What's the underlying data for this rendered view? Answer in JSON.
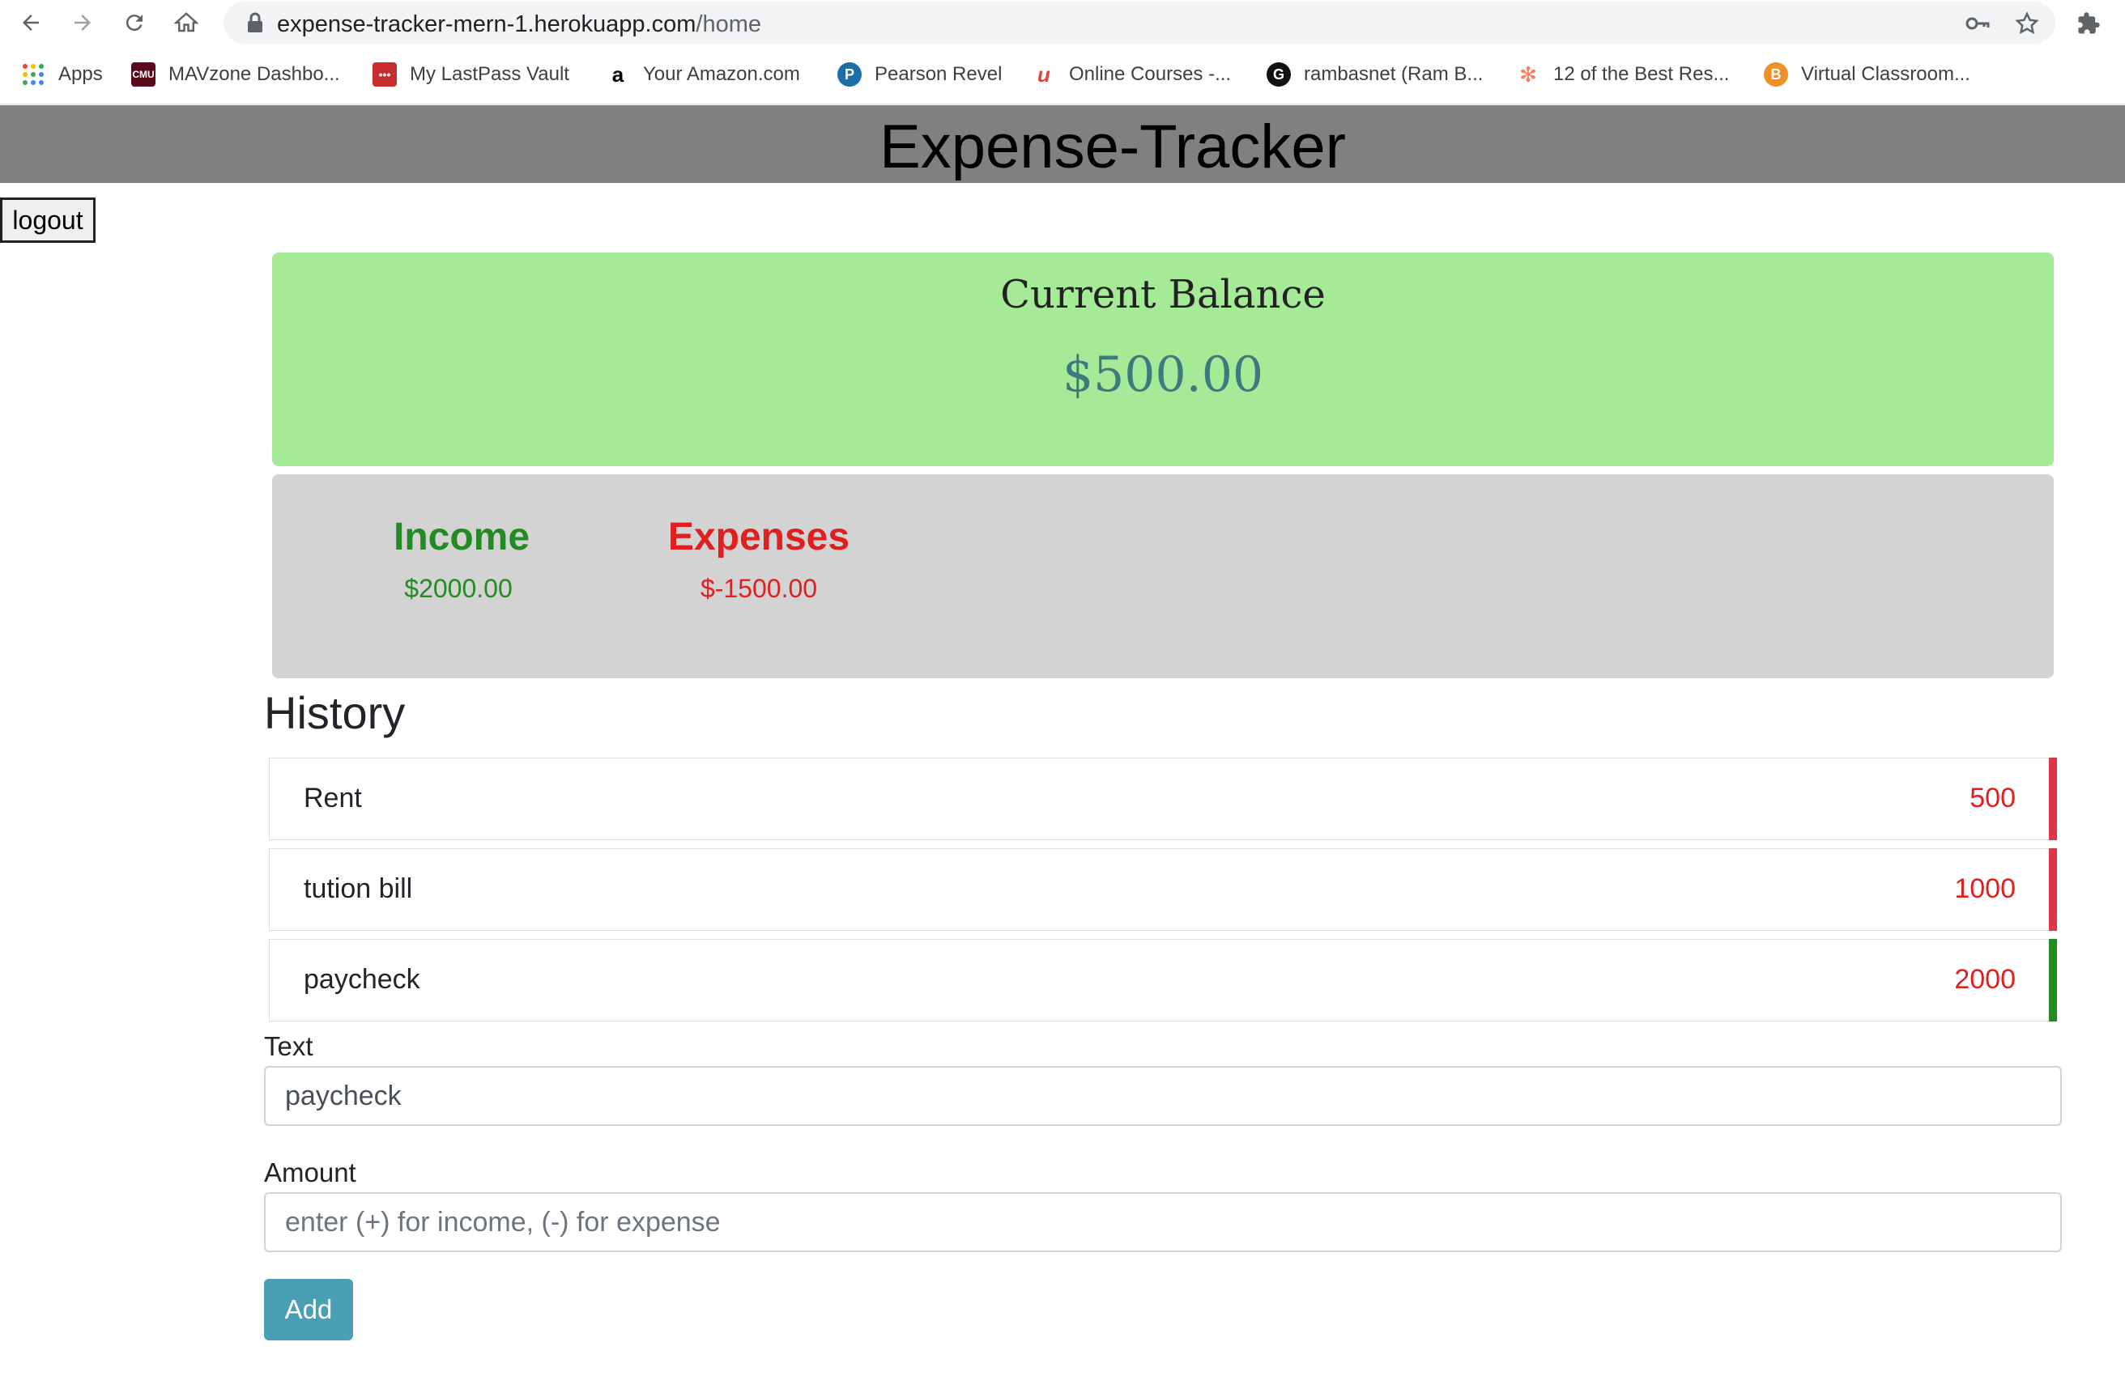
{
  "browser": {
    "url_host": "expense-tracker-mern-1.herokuapp.com",
    "url_path": "/home",
    "bookmarks": [
      {
        "label": "Apps",
        "icon": "apps-grid-icon"
      },
      {
        "label": "MAVzone Dashbo...",
        "icon": "cmu-icon"
      },
      {
        "label": "My LastPass Vault",
        "icon": "lastpass-icon"
      },
      {
        "label": "Your Amazon.com",
        "icon": "amazon-icon"
      },
      {
        "label": "Pearson Revel",
        "icon": "pearson-icon"
      },
      {
        "label": "Online Courses -...",
        "icon": "udemy-icon"
      },
      {
        "label": "rambasnet (Ram B...",
        "icon": "github-icon"
      },
      {
        "label": "12 of the Best Res...",
        "icon": "hubspot-icon"
      },
      {
        "label": "Virtual Classroom...",
        "icon": "bitcoin-icon"
      }
    ]
  },
  "header": {
    "title": "Expense-Tracker"
  },
  "logout_label": "logout",
  "balance": {
    "label": "Current Balance",
    "value": "$500.00"
  },
  "summary": {
    "income_label": "Income",
    "income_value": "$2000.00",
    "expense_label": "Expenses",
    "expense_value": "$-1500.00"
  },
  "history": {
    "title": "History",
    "items": [
      {
        "text": "Rent",
        "amount": "500",
        "type": "minus"
      },
      {
        "text": "tution bill",
        "amount": "1000",
        "type": "minus"
      },
      {
        "text": "paycheck",
        "amount": "2000",
        "type": "plus"
      }
    ]
  },
  "form": {
    "text_label": "Text",
    "text_value": "paycheck",
    "amount_label": "Amount",
    "amount_placeholder": "enter (+) for income, (-) for expense",
    "add_label": "Add"
  },
  "colors": {
    "balance_bg": "#a5ea96",
    "summary_bg": "#d3d3d3",
    "income": "#228b22",
    "expense": "#e02020",
    "add_button": "#4b9fb5"
  }
}
